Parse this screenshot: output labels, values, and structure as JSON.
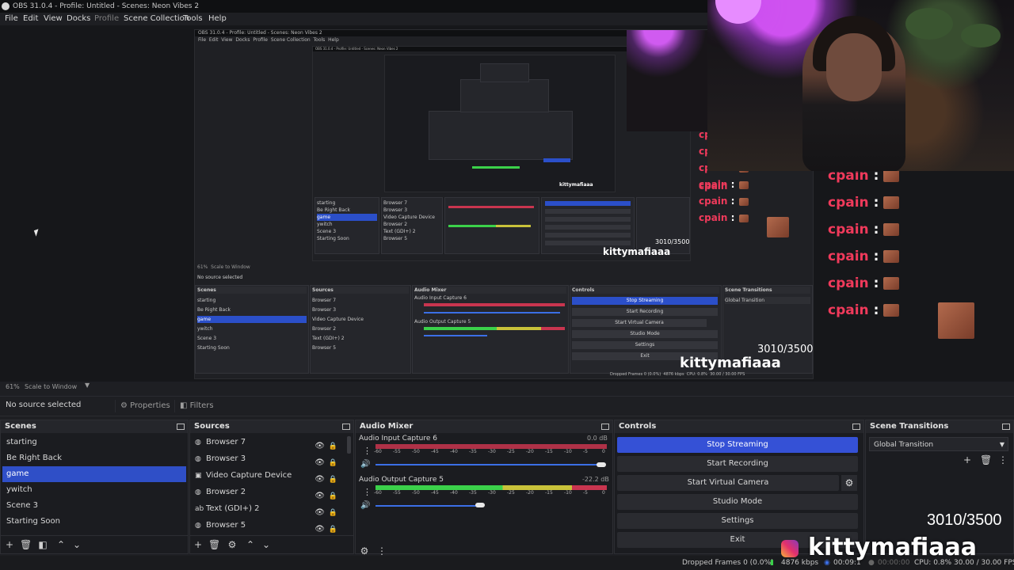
{
  "window": {
    "title": "OBS 31.0.4 - Profile: Untitled - Scenes: Neon Vibes 2"
  },
  "menu": [
    "File",
    "Edit",
    "View",
    "Docks",
    "Profile",
    "Scene Collection",
    "Tools",
    "Help"
  ],
  "preview": {
    "zoom": "61%",
    "scale_mode": "Scale to Window",
    "counter": "3010/3500",
    "brand": "kittymafiaaa",
    "chat_user": "cpain",
    "chat_sep": ":"
  },
  "source_toolbar": {
    "no_source": "No source selected",
    "properties": "Properties",
    "filters": "Filters"
  },
  "scenes": {
    "title": "Scenes",
    "items": [
      "starting",
      "Be Right Back",
      "game",
      "ywitch",
      "Scene 3",
      "Starting Soon"
    ],
    "selected": 2
  },
  "sources": {
    "title": "Sources",
    "items": [
      {
        "name": "Browser 7",
        "icon": "globe-icon"
      },
      {
        "name": "Browser 3",
        "icon": "globe-icon"
      },
      {
        "name": "Video Capture Device",
        "icon": "camera-icon"
      },
      {
        "name": "Browser 2",
        "icon": "globe-icon"
      },
      {
        "name": "Text (GDI+) 2",
        "icon": "text-icon"
      },
      {
        "name": "Browser 5",
        "icon": "globe-icon"
      }
    ]
  },
  "audio_mixer": {
    "title": "Audio Mixer",
    "channels": [
      {
        "name": "Audio Input Capture 6",
        "db": "0.0 dB",
        "level": 0.0
      },
      {
        "name": "Audio Output Capture 5",
        "db": "-22.2 dB",
        "level": 0.45
      }
    ],
    "ticks": [
      "-60",
      "-55",
      "-50",
      "-45",
      "-40",
      "-35",
      "-30",
      "-25",
      "-20",
      "-15",
      "-10",
      "-5",
      "0"
    ]
  },
  "controls": {
    "title": "Controls",
    "buttons": [
      "Stop Streaming",
      "Start Recording",
      "Start Virtual Camera",
      "Studio Mode",
      "Settings",
      "Exit"
    ]
  },
  "scene_transitions": {
    "title": "Scene Transitions",
    "selected": "Global Transition"
  },
  "status": {
    "dropped": "Dropped Frames 0 (0.0%)",
    "kbps": "4876 kbps",
    "time": "00:09:1",
    "rec_time": "00:00:00",
    "cpu": "CPU: 0.8%",
    "fps": "30.00 / 30.00 FPS"
  },
  "colors": {
    "accent": "#3551d6",
    "chat_name": "#f03a5b",
    "meter_green": "#3bd14a",
    "meter_yellow": "#c9c23a",
    "meter_red": "#c9354f"
  }
}
